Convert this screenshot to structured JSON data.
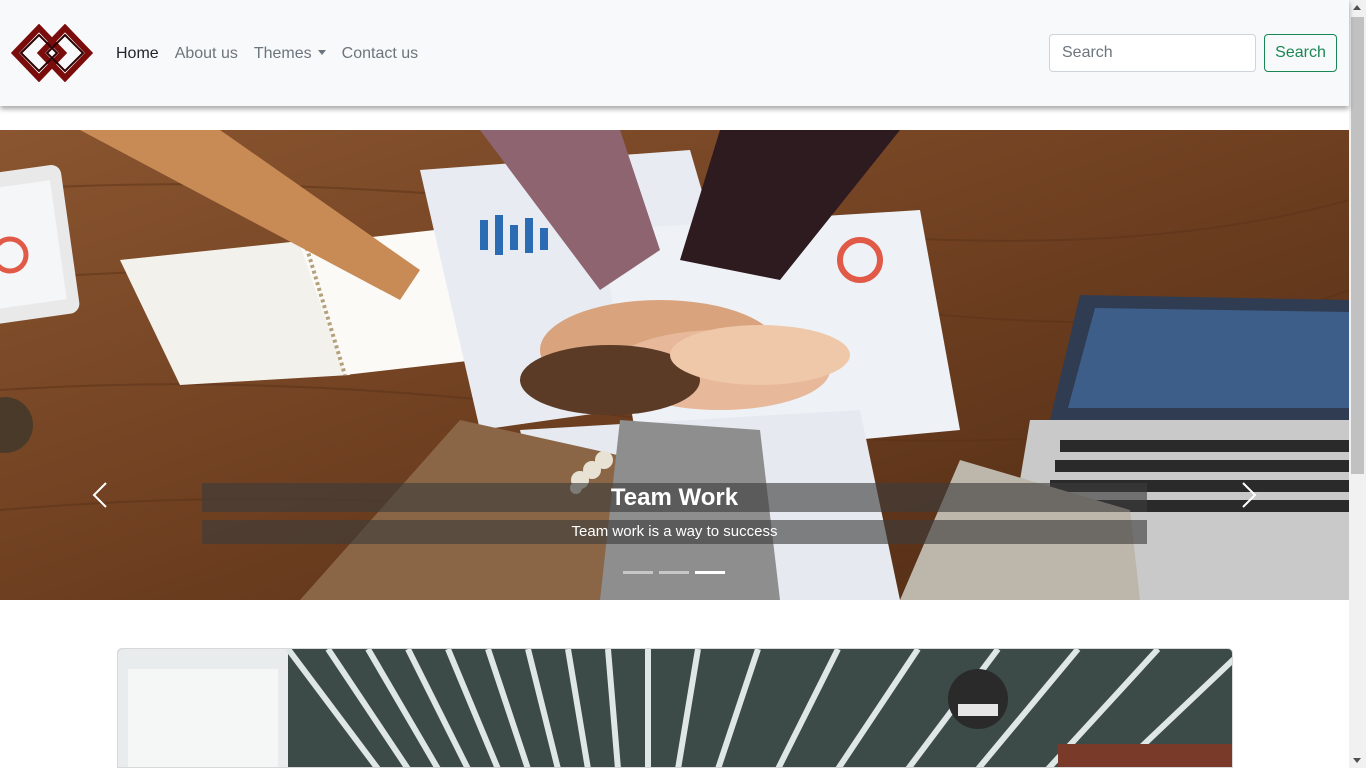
{
  "brand": {
    "logo_name": "brand-logo",
    "accent": "#7a0c0c"
  },
  "nav": {
    "items": [
      {
        "label": "Home",
        "active": true
      },
      {
        "label": "About us",
        "active": false
      },
      {
        "label": "Themes",
        "active": false,
        "dropdown": true
      },
      {
        "label": "Contact us",
        "active": false
      }
    ]
  },
  "search": {
    "placeholder": "Search",
    "button_label": "Search",
    "button_color": "#198754"
  },
  "carousel": {
    "slide_title": "Team Work",
    "slide_text": "Team work is a way to success",
    "slide_count": 3,
    "active_index": 2,
    "prev_icon": "chevron-left-icon",
    "next_icon": "chevron-right-icon"
  },
  "card": {
    "image": "conference-hall-photo"
  }
}
